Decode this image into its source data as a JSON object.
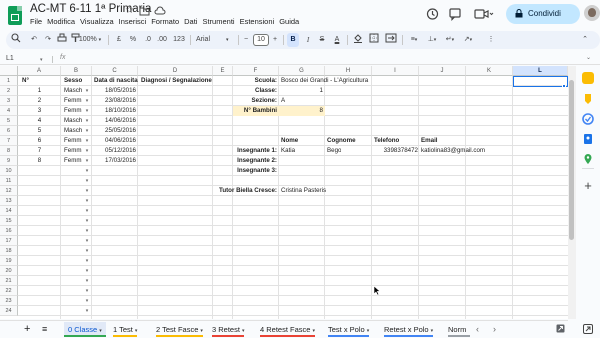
{
  "doc": {
    "title": "AC-MT 6-11 1ª Primaria"
  },
  "menu": [
    "File",
    "Modifica",
    "Visualizza",
    "Inserisci",
    "Formato",
    "Dati",
    "Strumenti",
    "Estensioni",
    "Guida"
  ],
  "share_label": "Condividi",
  "toolbar": {
    "zoom": "100%",
    "currency": "£",
    "percent": "%",
    "dec_less": ".0",
    "dec_more": ".00",
    "num_format": "123",
    "font": "Arial",
    "font_size": "10",
    "bold": "B"
  },
  "namebox": "L1",
  "fx": "fx",
  "columns": [
    "A",
    "B",
    "C",
    "D",
    "E",
    "F",
    "G",
    "H",
    "I",
    "J",
    "K",
    "L"
  ],
  "rows": [
    "1",
    "2",
    "3",
    "4",
    "5",
    "6",
    "7",
    "8",
    "9",
    "10",
    "11",
    "12",
    "13",
    "14",
    "15",
    "16",
    "17",
    "18",
    "19",
    "20",
    "21",
    "22",
    "23",
    "24"
  ],
  "headers": {
    "n": "N°",
    "sesso": "Sesso",
    "data": "Data di nascita",
    "diagnosi": "Diagnosi / Segnalazione"
  },
  "students": [
    {
      "n": "1",
      "sesso": "Masch",
      "data": "18/05/2016"
    },
    {
      "n": "2",
      "sesso": "Femm",
      "data": "23/08/2016"
    },
    {
      "n": "3",
      "sesso": "Femm",
      "data": "18/10/2016"
    },
    {
      "n": "4",
      "sesso": "Masch",
      "data": "14/06/2016"
    },
    {
      "n": "5",
      "sesso": "Masch",
      "data": "25/05/2016"
    },
    {
      "n": "6",
      "sesso": "Femm",
      "data": "04/06/2016"
    },
    {
      "n": "7",
      "sesso": "Femm",
      "data": "05/12/2016"
    },
    {
      "n": "8",
      "sesso": "Femm",
      "data": "17/03/2016"
    }
  ],
  "info": {
    "scuola_label": "Scuola:",
    "scuola_value": "Bosco dei Grandi - L'Agricultura",
    "classe_label": "Classe:",
    "classe_value": "1",
    "sezione_label": "Sezione:",
    "sezione_value": "A",
    "bambini_label": "N° Bambini",
    "bambini_value": "8"
  },
  "teachers": {
    "headers": {
      "nome": "Nome",
      "cognome": "Cognome",
      "telefono": "Telefono",
      "email": "Email"
    },
    "ins1_label": "Insegnante 1:",
    "ins1_nome": "Katia",
    "ins1_cognome": "Bego",
    "ins1_telefono": "3398378472",
    "ins1_email": "katiolina83@gmail.com",
    "ins2_label": "Insegnante 2:",
    "ins3_label": "Insegnante 3:",
    "tutor_label": "Tutor Biella Cresce:",
    "tutor_value": "Cristina Pasteris"
  },
  "tabs": [
    {
      "label": "0 Classe",
      "active": true,
      "color": "#34a853"
    },
    {
      "label": "1 Test",
      "color": "#fbbc04"
    },
    {
      "label": "2 Test Fasce",
      "color": "#fbbc04"
    },
    {
      "label": "3 Retest",
      "color": "#ea4335"
    },
    {
      "label": "4 Retest Fasce",
      "color": "#ea4335"
    },
    {
      "label": "Test x Polo",
      "color": "#4285f4"
    },
    {
      "label": "Retest x Polo",
      "color": "#4285f4"
    },
    {
      "label": "Norm",
      "color": "#9aa0a6"
    }
  ],
  "colors": {
    "accent": "#0b57d0",
    "share_bg": "#c2e7ff",
    "sheets_green": "#0f9d58",
    "highlight": "#fff2cc"
  }
}
